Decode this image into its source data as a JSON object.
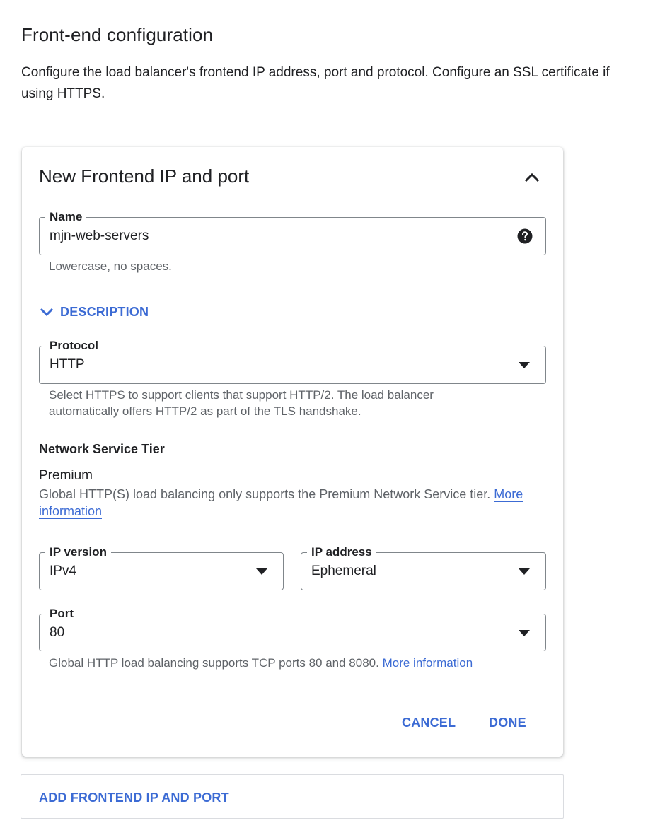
{
  "page": {
    "title": "Front-end configuration",
    "description": "Configure the load balancer's frontend IP address, port and protocol. Configure an SSL certificate if using HTTPS."
  },
  "card": {
    "title": "New Frontend IP and port",
    "name_field": {
      "label": "Name",
      "value": "mjn-web-servers",
      "hint": "Lowercase, no spaces."
    },
    "description_toggle": "DESCRIPTION",
    "protocol_field": {
      "label": "Protocol",
      "value": "HTTP",
      "hint": "Select HTTPS to support clients that support HTTP/2. The load balancer automatically offers HTTP/2 as part of the TLS handshake."
    },
    "network_tier": {
      "heading": "Network Service Tier",
      "value": "Premium",
      "description": "Global HTTP(S) load balancing only supports the Premium Network Service tier.",
      "link": "More information"
    },
    "ip_version_field": {
      "label": "IP version",
      "value": "IPv4"
    },
    "ip_address_field": {
      "label": "IP address",
      "value": "Ephemeral"
    },
    "port_field": {
      "label": "Port",
      "value": "80",
      "hint": "Global HTTP load balancing supports TCP ports 80 and 8080.",
      "link": "More information"
    },
    "cancel_label": "CANCEL",
    "done_label": "DONE"
  },
  "add_frontend_label": "ADD FRONTEND IP AND PORT",
  "colors": {
    "accent": "#3c6bd4",
    "text": "#202124",
    "secondary_text": "#5f6368",
    "border": "#80868b"
  },
  "icons": {
    "collapse": "chevron-up-icon",
    "help": "help-circle-icon",
    "description_toggle": "chevron-down-icon",
    "dropdown": "arrow-drop-down-icon"
  }
}
